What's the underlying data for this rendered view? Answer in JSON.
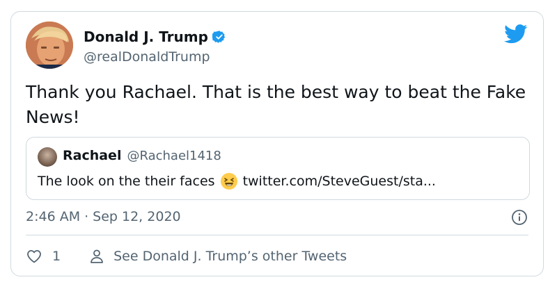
{
  "tweet": {
    "author": {
      "name": "Donald J. Trump",
      "handle": "@realDonaldTrump",
      "verified": true,
      "avatar_icon": "profile-photo"
    },
    "text": "Thank you Rachael. That is the best way to beat the Fake News!",
    "quoted": {
      "name": "Rachael",
      "handle": "@Rachael1418",
      "text": "The look on the their faces",
      "emoji_icon": "laughing-face-emoji",
      "link": "twitter.com/SteveGuest/sta..."
    },
    "time": "2:46 AM",
    "separator": "·",
    "date": "Sep 12, 2020",
    "actions": {
      "like_count": "1",
      "other_tweets_label": "See Donald J. Trump’s other Tweets"
    }
  },
  "colors": {
    "brand": "#1d9bf0",
    "text": "#0f1419",
    "secondary": "#536471",
    "border": "#cfd9de"
  }
}
